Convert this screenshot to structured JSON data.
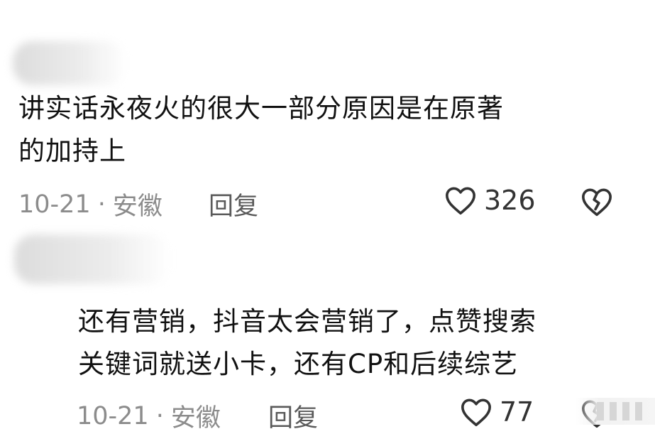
{
  "comments": [
    {
      "text_line1": "讲实话永夜火的很大一部分原因是在原著",
      "text_line2": "的加持上",
      "date": "10-21",
      "separator": "·",
      "location": "安徽",
      "reply_label": "回复",
      "likes": "326",
      "like_icon": "heart-outline-icon",
      "dislike_icon": "broken-heart-icon"
    },
    {
      "text_line1": "还有营销，抖音太会营销了，点赞搜索",
      "text_line2": "关键词就送小卡，还有CP和后续综艺",
      "date": "10-21",
      "separator": "·",
      "location": "安徽",
      "reply_label": "回复",
      "likes": "77",
      "like_icon": "heart-outline-icon",
      "dislike_icon": "broken-heart-icon"
    }
  ],
  "colors": {
    "text": "#111111",
    "meta": "#8c8c8c",
    "count": "#333333",
    "background": "#ffffff"
  }
}
